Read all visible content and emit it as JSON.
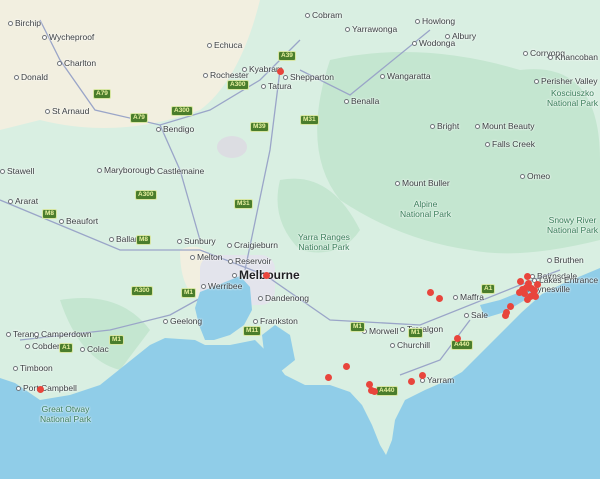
{
  "map": {
    "colors": {
      "land": "#d9efe2",
      "forest": "#bfe3cc",
      "dry": "#f3f0e2",
      "water": "#90cde8",
      "road": "#9aa5c8",
      "marker": "#e8453c"
    },
    "places": [
      "Birchip",
      "Wycheproof",
      "Charlton",
      "Donald",
      "St Arnaud",
      "Echuca",
      "Kyabram",
      "Rochester",
      "Tatura",
      "Shepparton",
      "Bendigo",
      "Maryborough",
      "Castlemaine",
      "Stawell",
      "Ararat",
      "Beaufort",
      "Ballarat",
      "Sunbury",
      "Craigieburn",
      "Melton",
      "Reservoir",
      "Melbourne",
      "Werribee",
      "Dandenong",
      "Geelong",
      "Frankston",
      "Terang",
      "Camperdown",
      "Cobden",
      "Colac",
      "Timboon",
      "Port Campbell",
      "Cobram",
      "Yarrawonga",
      "Howlong",
      "Albury",
      "Wodonga",
      "Corryong",
      "Khancoban",
      "Wangaratta",
      "Benalla",
      "Perisher Valley",
      "Bright",
      "Mount Beauty",
      "Falls Creek",
      "Omeo",
      "Mount Buller",
      "Bruthen",
      "Bairnsdale",
      "Paynesville",
      "Lakes Entrance",
      "Maffra",
      "Sale",
      "Traralgon",
      "Morwell",
      "Churchill",
      "Yarram"
    ],
    "parks": [
      "Alpine\nNational Park",
      "Yarra Ranges\nNational Park",
      "Great Otway\nNational Park",
      "Kosciuszko\nNational Park",
      "Snowy River\nNational Park"
    ],
    "roads": [
      "A39",
      "A300",
      "A79",
      "A79",
      "A300",
      "M39",
      "A300",
      "M31",
      "M31",
      "M8",
      "M8",
      "M1",
      "A300",
      "M1",
      "A1",
      "M1",
      "M11",
      "M1",
      "A1",
      "A440",
      "A440"
    ],
    "marker_count": 30
  }
}
